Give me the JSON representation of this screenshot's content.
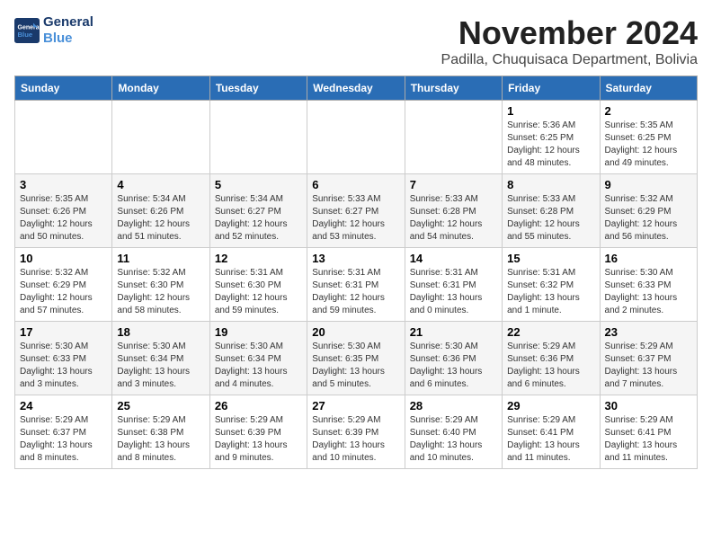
{
  "logo": {
    "line1": "General",
    "line2": "Blue"
  },
  "title": "November 2024",
  "location": "Padilla, Chuquisaca Department, Bolivia",
  "weekdays": [
    "Sunday",
    "Monday",
    "Tuesday",
    "Wednesday",
    "Thursday",
    "Friday",
    "Saturday"
  ],
  "weeks": [
    [
      {
        "day": "",
        "info": ""
      },
      {
        "day": "",
        "info": ""
      },
      {
        "day": "",
        "info": ""
      },
      {
        "day": "",
        "info": ""
      },
      {
        "day": "",
        "info": ""
      },
      {
        "day": "1",
        "info": "Sunrise: 5:36 AM\nSunset: 6:25 PM\nDaylight: 12 hours and 48 minutes."
      },
      {
        "day": "2",
        "info": "Sunrise: 5:35 AM\nSunset: 6:25 PM\nDaylight: 12 hours and 49 minutes."
      }
    ],
    [
      {
        "day": "3",
        "info": "Sunrise: 5:35 AM\nSunset: 6:26 PM\nDaylight: 12 hours and 50 minutes."
      },
      {
        "day": "4",
        "info": "Sunrise: 5:34 AM\nSunset: 6:26 PM\nDaylight: 12 hours and 51 minutes."
      },
      {
        "day": "5",
        "info": "Sunrise: 5:34 AM\nSunset: 6:27 PM\nDaylight: 12 hours and 52 minutes."
      },
      {
        "day": "6",
        "info": "Sunrise: 5:33 AM\nSunset: 6:27 PM\nDaylight: 12 hours and 53 minutes."
      },
      {
        "day": "7",
        "info": "Sunrise: 5:33 AM\nSunset: 6:28 PM\nDaylight: 12 hours and 54 minutes."
      },
      {
        "day": "8",
        "info": "Sunrise: 5:33 AM\nSunset: 6:28 PM\nDaylight: 12 hours and 55 minutes."
      },
      {
        "day": "9",
        "info": "Sunrise: 5:32 AM\nSunset: 6:29 PM\nDaylight: 12 hours and 56 minutes."
      }
    ],
    [
      {
        "day": "10",
        "info": "Sunrise: 5:32 AM\nSunset: 6:29 PM\nDaylight: 12 hours and 57 minutes."
      },
      {
        "day": "11",
        "info": "Sunrise: 5:32 AM\nSunset: 6:30 PM\nDaylight: 12 hours and 58 minutes."
      },
      {
        "day": "12",
        "info": "Sunrise: 5:31 AM\nSunset: 6:30 PM\nDaylight: 12 hours and 59 minutes."
      },
      {
        "day": "13",
        "info": "Sunrise: 5:31 AM\nSunset: 6:31 PM\nDaylight: 12 hours and 59 minutes."
      },
      {
        "day": "14",
        "info": "Sunrise: 5:31 AM\nSunset: 6:31 PM\nDaylight: 13 hours and 0 minutes."
      },
      {
        "day": "15",
        "info": "Sunrise: 5:31 AM\nSunset: 6:32 PM\nDaylight: 13 hours and 1 minute."
      },
      {
        "day": "16",
        "info": "Sunrise: 5:30 AM\nSunset: 6:33 PM\nDaylight: 13 hours and 2 minutes."
      }
    ],
    [
      {
        "day": "17",
        "info": "Sunrise: 5:30 AM\nSunset: 6:33 PM\nDaylight: 13 hours and 3 minutes."
      },
      {
        "day": "18",
        "info": "Sunrise: 5:30 AM\nSunset: 6:34 PM\nDaylight: 13 hours and 3 minutes."
      },
      {
        "day": "19",
        "info": "Sunrise: 5:30 AM\nSunset: 6:34 PM\nDaylight: 13 hours and 4 minutes."
      },
      {
        "day": "20",
        "info": "Sunrise: 5:30 AM\nSunset: 6:35 PM\nDaylight: 13 hours and 5 minutes."
      },
      {
        "day": "21",
        "info": "Sunrise: 5:30 AM\nSunset: 6:36 PM\nDaylight: 13 hours and 6 minutes."
      },
      {
        "day": "22",
        "info": "Sunrise: 5:29 AM\nSunset: 6:36 PM\nDaylight: 13 hours and 6 minutes."
      },
      {
        "day": "23",
        "info": "Sunrise: 5:29 AM\nSunset: 6:37 PM\nDaylight: 13 hours and 7 minutes."
      }
    ],
    [
      {
        "day": "24",
        "info": "Sunrise: 5:29 AM\nSunset: 6:37 PM\nDaylight: 13 hours and 8 minutes."
      },
      {
        "day": "25",
        "info": "Sunrise: 5:29 AM\nSunset: 6:38 PM\nDaylight: 13 hours and 8 minutes."
      },
      {
        "day": "26",
        "info": "Sunrise: 5:29 AM\nSunset: 6:39 PM\nDaylight: 13 hours and 9 minutes."
      },
      {
        "day": "27",
        "info": "Sunrise: 5:29 AM\nSunset: 6:39 PM\nDaylight: 13 hours and 10 minutes."
      },
      {
        "day": "28",
        "info": "Sunrise: 5:29 AM\nSunset: 6:40 PM\nDaylight: 13 hours and 10 minutes."
      },
      {
        "day": "29",
        "info": "Sunrise: 5:29 AM\nSunset: 6:41 PM\nDaylight: 13 hours and 11 minutes."
      },
      {
        "day": "30",
        "info": "Sunrise: 5:29 AM\nSunset: 6:41 PM\nDaylight: 13 hours and 11 minutes."
      }
    ]
  ]
}
